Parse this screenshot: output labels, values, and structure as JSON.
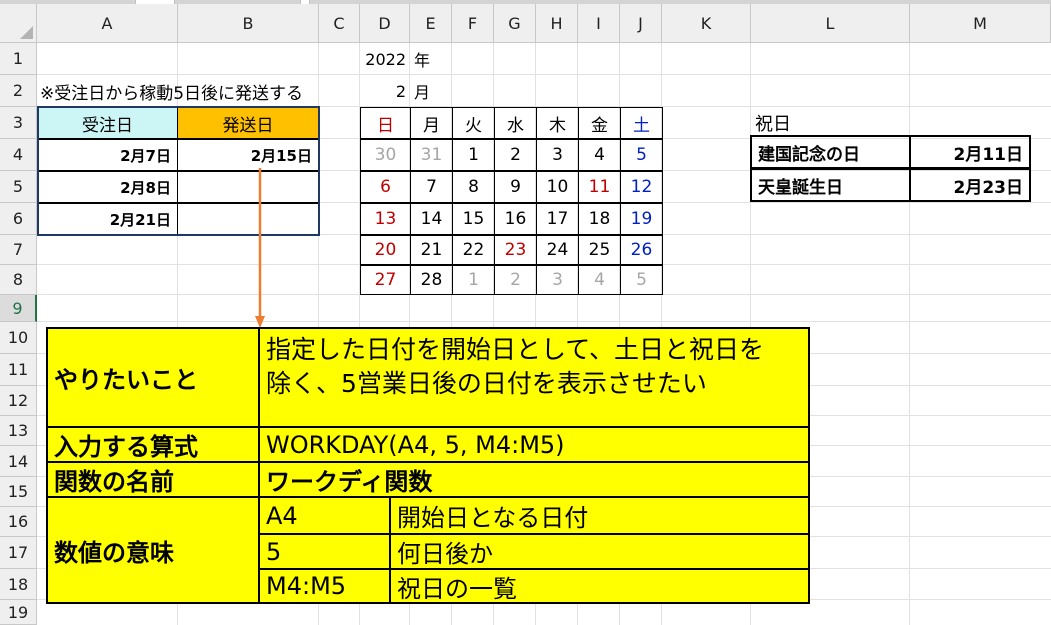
{
  "columns": [
    "A",
    "B",
    "C",
    "D",
    "E",
    "F",
    "G",
    "H",
    "I",
    "J",
    "K",
    "L",
    "M"
  ],
  "rows": [
    "1",
    "2",
    "3",
    "4",
    "5",
    "6",
    "7",
    "8",
    "9",
    "10",
    "11",
    "12",
    "13",
    "14",
    "15",
    "16",
    "17",
    "18",
    "19"
  ],
  "selected_row": "9",
  "header": {
    "year_value": "2022",
    "year_unit": "年",
    "month_value": "2",
    "month_unit": "月",
    "note": "※受注日から稼動5日後に発送する"
  },
  "order_table": {
    "headers": [
      "受注日",
      "発送日"
    ],
    "rows": [
      [
        "2月7日",
        "2月15日"
      ],
      [
        "2月8日",
        ""
      ],
      [
        "2月21日",
        ""
      ]
    ]
  },
  "calendar": {
    "weekdays": [
      "日",
      "月",
      "火",
      "水",
      "木",
      "金",
      "土"
    ],
    "weeks": [
      [
        "30",
        "31",
        "1",
        "2",
        "3",
        "4",
        "5"
      ],
      [
        "6",
        "7",
        "8",
        "9",
        "10",
        "11",
        "12"
      ],
      [
        "13",
        "14",
        "15",
        "16",
        "17",
        "18",
        "19"
      ],
      [
        "20",
        "21",
        "22",
        "23",
        "24",
        "25",
        "26"
      ],
      [
        "27",
        "28",
        "1",
        "2",
        "3",
        "4",
        "5"
      ]
    ],
    "colors": {
      "sunday": "#c00000",
      "saturday": "#0020c0",
      "holiday": "#c00000",
      "other_month": "#a6a6a6",
      "normal": "#000000"
    }
  },
  "holidays": {
    "title": "祝日",
    "rows": [
      [
        "建国記念の日",
        "2月11日"
      ],
      [
        "天皇誕生日",
        "2月23日"
      ]
    ]
  },
  "explain_box": {
    "want_label": "やりたいこと",
    "want_text_line1": "指定した日付を開始日として、土日と祝日を",
    "want_text_line2": "除く、5営業日後の日付を表示させたい",
    "formula_label": "入力する算式",
    "formula_text": "WORKDAY(A4, 5, M4:M5)",
    "func_label": "関数の名前",
    "func_text": "ワークディ関数",
    "meaning_label": "数値の意味",
    "args": [
      [
        "A4",
        "開始日となる日付"
      ],
      [
        "5",
        "何日後か"
      ],
      [
        "M4:M5",
        "祝日の一覧"
      ]
    ]
  },
  "colors": {
    "accent_green": "#217346",
    "header_cyan": "#ccf5f5",
    "header_orange": "#ffc000",
    "box_yellow": "#ffff00",
    "arrow": "#ed7d31"
  }
}
